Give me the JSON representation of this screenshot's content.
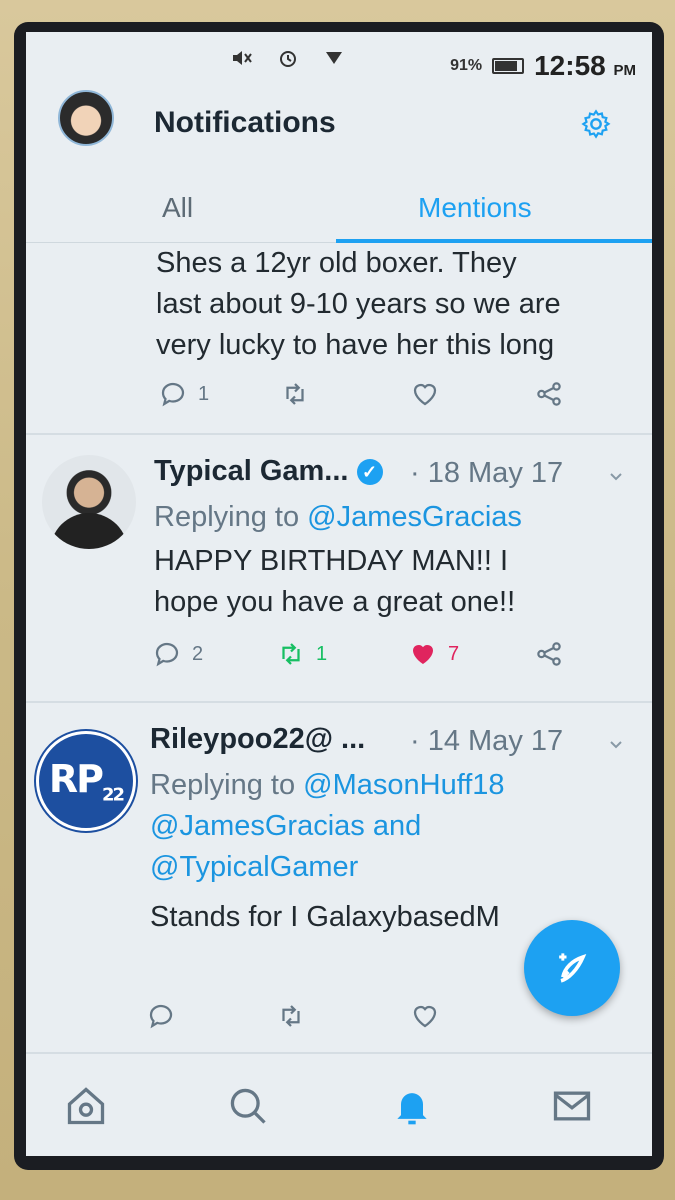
{
  "status_bar": {
    "battery": "91%",
    "time": "12:58",
    "ampm": "PM"
  },
  "header": {
    "title": "Notifications"
  },
  "tabs": [
    {
      "label": "All",
      "active": false
    },
    {
      "label": "Mentions",
      "active": true
    }
  ],
  "tweets": [
    {
      "lines": [
        "Shes a 12yr old boxer. They",
        "last about 9-10 years so we are",
        "very lucky to have her this long"
      ],
      "replies": "1",
      "retweets": "",
      "likes": ""
    },
    {
      "name": "Typical Gam...",
      "date": "· 18 May 17",
      "replying_prefix": "Replying to",
      "replying_to": "@JamesGracias",
      "lines": [
        "HAPPY BIRTHDAY MAN!! I",
        "hope you have a great one!!"
      ],
      "replies": "2",
      "retweets": "1",
      "likes": "7"
    },
    {
      "name": "Rileypoo22@ ...",
      "date": "· 14 May 17",
      "avatar_text": "RP",
      "avatar_sub": "22",
      "replying_prefix": "Replying to",
      "replying_to_1": "@MasonHuff18",
      "replying_to_2": "@JamesGracias",
      "replying_and": "and",
      "replying_to_3": "@TypicalGamer",
      "lines": [
        "Stands for I GalaxybasedM"
      ],
      "replies": "",
      "retweets": "",
      "likes": ""
    }
  ],
  "colors": {
    "accent": "#1da1f2",
    "retweet_active": "#17bf63",
    "like_active": "#e0245e"
  },
  "nav": [
    "home-icon",
    "search-icon",
    "notifications-icon",
    "messages-icon"
  ]
}
